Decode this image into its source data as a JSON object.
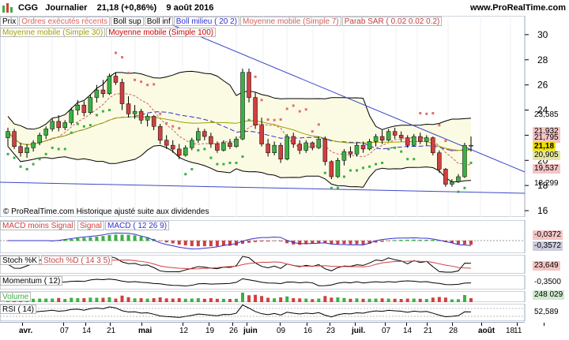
{
  "header": {
    "symbol": "CGG",
    "period": "Journalier",
    "price_change": "21,18 (+0,86%)",
    "date": "9 août 2016",
    "site": "www.ProRealTime.com"
  },
  "legend_row1": [
    {
      "label": "Prix",
      "color": "#000000"
    },
    {
      "label": "Ordres exécutés récents",
      "color": "#e06060"
    },
    {
      "label": "Boll sup",
      "color": "#000000"
    },
    {
      "label": "Boll inf",
      "color": "#000000"
    },
    {
      "label": "Boll milieu ( 20 2)",
      "color": "#3030d0"
    },
    {
      "label": "Moyenne mobile (Simple 7)",
      "color": "#d06060"
    },
    {
      "label": "Parab SAR ( 0.02 0.02 0.2)",
      "color": "#c04040"
    }
  ],
  "legend_row2": [
    {
      "label": "Moyenne mobile (Simple 30)",
      "color": "#a0a000"
    },
    {
      "label": "Moyenne mobile (Simple 100)",
      "color": "#d00000"
    }
  ],
  "price_axis": [
    "30",
    "28",
    "26",
    "24",
    "22",
    "20",
    "18",
    "16"
  ],
  "price_tags": {
    "t1": "23,585",
    "t2": "21,932",
    "t3": "21,795",
    "t4": "21,18",
    "t5": "20,905",
    "t6": "19,537",
    "t7": "18,299"
  },
  "watermark": "© ProRealTime.com Historique ajusté suite aux dividendes",
  "macd": {
    "legend": [
      "MACD moins Signal",
      "Signal",
      "MACD ( 12 26 9)"
    ],
    "value1": "-0,0372",
    "value2": "-0,3572"
  },
  "stoch": {
    "legend": [
      "Stoch %K",
      "Stoch %D ( 14 3 5)"
    ],
    "value": "23,649"
  },
  "momentum": {
    "legend": "Momentum ( 12)",
    "value": "-0,3500"
  },
  "volume": {
    "legend": "Volume",
    "value": "248 029"
  },
  "rsi": {
    "legend": "RSI ( 14)",
    "value": "52,589"
  },
  "x_axis": [
    "avr.",
    "07",
    "14",
    "21",
    "mai",
    "12",
    "19",
    "26",
    "juin",
    "09",
    "16",
    "23",
    "juil.",
    "07",
    "14",
    "21",
    "28",
    "août",
    "11",
    "18"
  ],
  "colors": {
    "up": "#3cb043",
    "down": "#d04040",
    "bollinger_fill": "#fbfbe4",
    "sar_up": "#3cb043",
    "sar_down": "#e07070"
  },
  "chart_data": {
    "type": "candlestick",
    "ylim": [
      15.5,
      31.5
    ],
    "candles": [
      [
        21.8,
        22.6,
        21.1,
        22.3
      ],
      [
        22.3,
        22.5,
        20.9,
        21.1
      ],
      [
        21.1,
        21.4,
        20.3,
        20.6
      ],
      [
        20.6,
        21.3,
        20.2,
        21.0
      ],
      [
        21.0,
        21.6,
        20.7,
        21.4
      ],
      [
        21.4,
        22.2,
        21.2,
        22.0
      ],
      [
        22.0,
        22.7,
        21.7,
        22.5
      ],
      [
        22.5,
        23.3,
        22.3,
        23.1
      ],
      [
        23.1,
        23.6,
        22.3,
        22.6
      ],
      [
        22.6,
        23.2,
        22.4,
        23.0
      ],
      [
        23.0,
        24.2,
        22.8,
        24.0
      ],
      [
        24.0,
        24.8,
        23.6,
        24.4
      ],
      [
        24.4,
        24.7,
        23.5,
        23.8
      ],
      [
        23.8,
        25.2,
        23.7,
        25.0
      ],
      [
        25.0,
        26.0,
        24.6,
        25.6
      ],
      [
        25.6,
        26.4,
        25.0,
        25.3
      ],
      [
        25.3,
        26.9,
        25.2,
        26.7
      ],
      [
        26.7,
        27.0,
        26.0,
        26.2
      ],
      [
        26.2,
        26.5,
        24.0,
        24.5
      ],
      [
        24.5,
        25.1,
        23.4,
        23.7
      ],
      [
        23.7,
        24.4,
        23.3,
        23.9
      ],
      [
        23.9,
        24.1,
        22.9,
        23.2
      ],
      [
        23.2,
        23.7,
        22.7,
        23.5
      ],
      [
        23.5,
        23.6,
        22.4,
        22.7
      ],
      [
        22.7,
        22.9,
        21.3,
        21.6
      ],
      [
        21.6,
        22.0,
        20.9,
        21.2
      ],
      [
        21.2,
        21.6,
        20.6,
        20.9
      ],
      [
        20.9,
        21.3,
        20.1,
        20.4
      ],
      [
        20.4,
        21.2,
        20.3,
        21.0
      ],
      [
        21.0,
        21.8,
        20.8,
        21.6
      ],
      [
        21.6,
        22.6,
        21.4,
        22.3
      ],
      [
        22.3,
        22.5,
        21.6,
        21.9
      ],
      [
        21.9,
        22.2,
        21.0,
        21.3
      ],
      [
        21.3,
        21.5,
        20.6,
        20.8
      ],
      [
        20.8,
        21.6,
        20.7,
        21.4
      ],
      [
        21.4,
        21.7,
        20.9,
        21.1
      ],
      [
        21.1,
        21.9,
        21.0,
        21.7
      ],
      [
        21.7,
        27.3,
        21.6,
        27.0
      ],
      [
        27.0,
        27.3,
        24.6,
        25.0
      ],
      [
        25.0,
        25.4,
        22.5,
        22.8
      ],
      [
        22.8,
        23.4,
        21.1,
        21.3
      ],
      [
        21.3,
        21.7,
        20.3,
        20.6
      ],
      [
        20.6,
        21.5,
        20.4,
        21.2
      ],
      [
        21.2,
        21.4,
        19.8,
        20.1
      ],
      [
        20.1,
        22.1,
        20.0,
        21.9
      ],
      [
        21.9,
        22.2,
        21.0,
        21.3
      ],
      [
        21.3,
        21.6,
        20.5,
        20.8
      ],
      [
        20.8,
        21.6,
        20.6,
        21.4
      ],
      [
        21.4,
        21.5,
        20.8,
        21.0
      ],
      [
        21.0,
        21.9,
        20.9,
        21.7
      ],
      [
        21.7,
        21.9,
        19.6,
        19.9
      ],
      [
        19.9,
        20.0,
        18.5,
        18.7
      ],
      [
        18.7,
        20.2,
        18.6,
        20.0
      ],
      [
        20.0,
        20.9,
        19.6,
        20.7
      ],
      [
        20.7,
        21.1,
        20.2,
        20.5
      ],
      [
        20.5,
        21.4,
        20.3,
        21.2
      ],
      [
        21.2,
        21.5,
        20.6,
        20.9
      ],
      [
        20.9,
        21.7,
        20.8,
        21.5
      ],
      [
        21.5,
        22.1,
        21.1,
        21.9
      ],
      [
        21.9,
        22.4,
        21.3,
        21.6
      ],
      [
        21.6,
        22.5,
        21.5,
        22.3
      ],
      [
        22.3,
        22.6,
        21.7,
        22.0
      ],
      [
        22.0,
        22.3,
        21.5,
        21.8
      ],
      [
        21.8,
        22.0,
        21.0,
        21.2
      ],
      [
        21.2,
        22.1,
        21.1,
        21.9
      ],
      [
        21.9,
        22.2,
        21.3,
        21.5
      ],
      [
        21.5,
        22.0,
        21.2,
        21.8
      ],
      [
        21.8,
        21.9,
        20.4,
        20.6
      ],
      [
        20.6,
        20.8,
        19.0,
        19.3
      ],
      [
        19.3,
        19.4,
        17.9,
        18.1
      ],
      [
        18.1,
        18.5,
        17.9,
        18.3
      ],
      [
        18.3,
        18.9,
        18.2,
        18.7
      ],
      [
        18.7,
        21.4,
        18.6,
        21.2
      ],
      [
        21.2,
        21.9,
        20.7,
        21.18
      ]
    ]
  }
}
